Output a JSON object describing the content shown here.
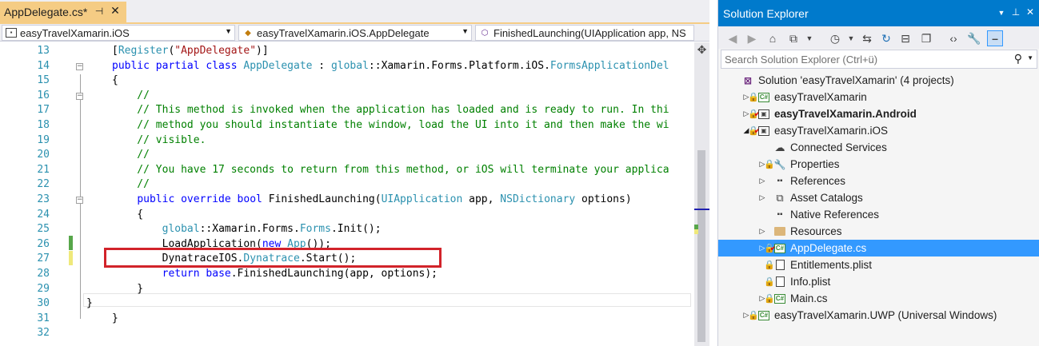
{
  "editor": {
    "tab": {
      "title": "AppDelegate.cs*",
      "pin_icon": "pin-icon",
      "close_icon": "close-icon"
    },
    "nav": {
      "project": "easyTravelXamarin.iOS",
      "type": "easyTravelXamarin.iOS.AppDelegate",
      "member": "FinishedLaunching(UIApplication app, NS"
    },
    "lines": [
      {
        "n": "13",
        "code": [
          [
            "",
            "[",
            "p"
          ],
          [
            "ty",
            "Register"
          ],
          [
            "",
            "("
          ],
          [
            "st",
            "\"AppDelegate\""
          ],
          [
            "",
            ")]"
          ]
        ]
      },
      {
        "n": "14",
        "code": [
          [
            "kw",
            "public partial class "
          ],
          [
            "ty",
            "AppDelegate"
          ],
          [
            "",
            " : "
          ],
          [
            "ty",
            "global"
          ],
          [
            "",
            "::Xamarin.Forms.Platform.iOS."
          ],
          [
            "ty",
            "FormsApplicationDel"
          ]
        ]
      },
      {
        "n": "15",
        "code": [
          [
            "",
            "{"
          ]
        ]
      },
      {
        "n": "16",
        "code": [
          [
            "cm",
            "    //"
          ]
        ]
      },
      {
        "n": "17",
        "code": [
          [
            "cm",
            "    // This method is invoked when the application has loaded and is ready to run. In thi"
          ]
        ]
      },
      {
        "n": "18",
        "code": [
          [
            "cm",
            "    // method you should instantiate the window, load the UI into it and then make the wi"
          ]
        ]
      },
      {
        "n": "19",
        "code": [
          [
            "cm",
            "    // visible."
          ]
        ]
      },
      {
        "n": "20",
        "code": [
          [
            "cm",
            "    //"
          ]
        ]
      },
      {
        "n": "21",
        "code": [
          [
            "cm",
            "    // You have 17 seconds to return from this method, or iOS will terminate your applica"
          ]
        ]
      },
      {
        "n": "22",
        "code": [
          [
            "cm",
            "    //"
          ]
        ]
      },
      {
        "n": "23",
        "code": [
          [
            "",
            "    "
          ],
          [
            "kw",
            "public override bool "
          ],
          [
            "",
            "FinishedLaunching("
          ],
          [
            "ty",
            "UIApplication"
          ],
          [
            "",
            " app, "
          ],
          [
            "ty",
            "NSDictionary"
          ],
          [
            "",
            " options)"
          ]
        ]
      },
      {
        "n": "24",
        "code": [
          [
            "",
            "    {"
          ]
        ]
      },
      {
        "n": "25",
        "code": [
          [
            "",
            "        "
          ],
          [
            "ty",
            "global"
          ],
          [
            "",
            "::Xamarin.Forms."
          ],
          [
            "ty",
            "Forms"
          ],
          [
            "",
            ".Init();"
          ]
        ]
      },
      {
        "n": "26",
        "code": [
          [
            "",
            "        LoadApplication("
          ],
          [
            "kw",
            "new "
          ],
          [
            "ty",
            "App"
          ],
          [
            "",
            "());"
          ]
        ]
      },
      {
        "n": "27",
        "code": [
          [
            "",
            "        DynatraceIOS."
          ],
          [
            "ty",
            "Dynatrace"
          ],
          [
            "",
            ".Start();"
          ]
        ]
      },
      {
        "n": "28",
        "code": [
          [
            "",
            "        "
          ],
          [
            "kw",
            "return base"
          ],
          [
            "",
            ".FinishedLaunching(app, options);"
          ]
        ]
      },
      {
        "n": "29",
        "code": [
          [
            "",
            "    }"
          ]
        ]
      },
      {
        "n": "30",
        "code": [
          [
            "",
            "}"
          ]
        ]
      },
      {
        "n": "31",
        "code": [
          [
            "",
            "}"
          ]
        ]
      },
      {
        "n": "32",
        "code": [
          [
            "",
            ""
          ]
        ]
      }
    ]
  },
  "solution_explorer": {
    "title": "Solution Explorer",
    "search_placeholder": "Search Solution Explorer (Ctrl+ü)",
    "tree": [
      {
        "label": "Solution 'easyTravelXamarin' (4 projects)",
        "icon": "solution-icon",
        "expander": "",
        "bold": false,
        "selected": false
      },
      {
        "label": "easyTravelXamarin",
        "icon": "csharp-project-icon",
        "expander": "collapsed",
        "bold": false,
        "selected": false
      },
      {
        "label": "easyTravelXamarin.Android",
        "icon": "android-project-icon",
        "expander": "collapsed",
        "bold": true,
        "selected": false
      },
      {
        "label": "easyTravelXamarin.iOS",
        "icon": "ios-project-icon",
        "expander": "expanded",
        "bold": false,
        "selected": false
      },
      {
        "label": "Connected Services",
        "icon": "connected-services-icon",
        "expander": "",
        "bold": false,
        "selected": false
      },
      {
        "label": "Properties",
        "icon": "wrench-icon",
        "expander": "collapsed",
        "bold": false,
        "selected": false
      },
      {
        "label": "References",
        "icon": "references-icon",
        "expander": "collapsed",
        "bold": false,
        "selected": false
      },
      {
        "label": "Asset Catalogs",
        "icon": "asset-catalogs-icon",
        "expander": "collapsed",
        "bold": false,
        "selected": false
      },
      {
        "label": "Native References",
        "icon": "native-references-icon",
        "expander": "",
        "bold": false,
        "selected": false
      },
      {
        "label": "Resources",
        "icon": "folder-icon",
        "expander": "collapsed",
        "bold": false,
        "selected": false
      },
      {
        "label": "AppDelegate.cs",
        "icon": "csharp-file-icon",
        "expander": "collapsed",
        "bold": false,
        "selected": true
      },
      {
        "label": "Entitlements.plist",
        "icon": "file-icon",
        "expander": "",
        "bold": false,
        "selected": false
      },
      {
        "label": "Info.plist",
        "icon": "file-icon",
        "expander": "",
        "bold": false,
        "selected": false
      },
      {
        "label": "Main.cs",
        "icon": "csharp-file-icon",
        "expander": "collapsed",
        "bold": false,
        "selected": false
      },
      {
        "label": "easyTravelXamarin.UWP (Universal Windows)",
        "icon": "csharp-project-icon",
        "expander": "collapsed",
        "bold": false,
        "selected": false
      }
    ]
  },
  "colors": {
    "accent": "#007acc",
    "tab_active": "#f5cc84",
    "selection": "#3399ff",
    "highlight_box": "#d2232a"
  }
}
